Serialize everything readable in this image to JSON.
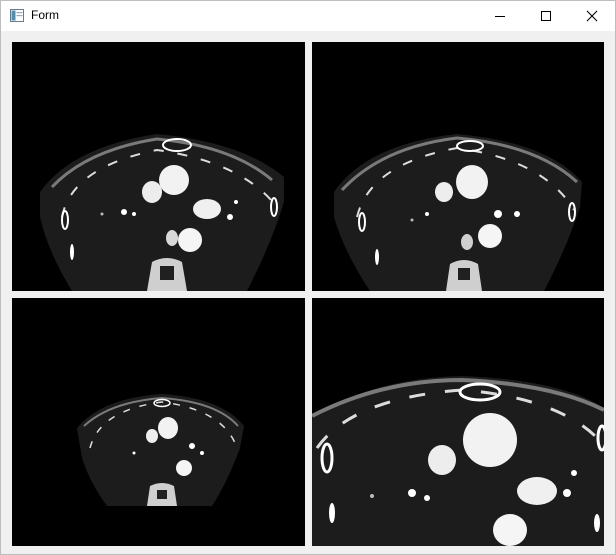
{
  "window": {
    "title": "Form",
    "icons": {
      "app": "form-app-icon",
      "minimize": "minimize-icon",
      "maximize": "maximize-icon",
      "close": "close-icon"
    }
  },
  "viewports": [
    {
      "id": "top-left",
      "content": "ct-axial-slice"
    },
    {
      "id": "top-right",
      "content": "ct-axial-slice"
    },
    {
      "id": "bottom-left",
      "content": "ct-axial-slice"
    },
    {
      "id": "bottom-right",
      "content": "ct-axial-slice-zoomed"
    }
  ],
  "colors": {
    "viewport_bg": "#000000",
    "window_bg": "#f0f0f0",
    "titlebar_bg": "#ffffff"
  }
}
